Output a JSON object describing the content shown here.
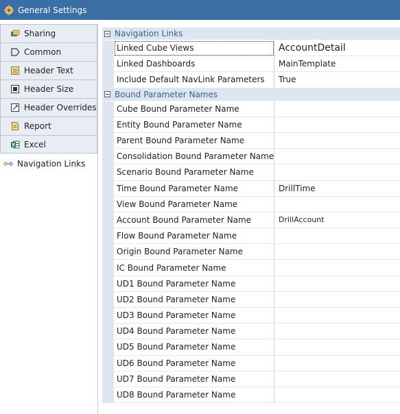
{
  "window": {
    "title": "General Settings"
  },
  "sidebar": {
    "items": [
      {
        "label": "Sharing",
        "icon": "sharing-icon"
      },
      {
        "label": "Common",
        "icon": "common-icon"
      },
      {
        "label": "Header Text",
        "icon": "header-text-icon"
      },
      {
        "label": "Header Size",
        "icon": "header-size-icon"
      },
      {
        "label": "Header Overrides",
        "icon": "header-overrides-icon"
      },
      {
        "label": "Report",
        "icon": "report-icon"
      },
      {
        "label": "Excel",
        "icon": "excel-icon"
      },
      {
        "label": "Navigation Links",
        "icon": "navigation-links-icon",
        "active": true
      }
    ]
  },
  "grid": {
    "nav": {
      "label": "Navigation Links",
      "rows": [
        {
          "name": "Linked Cube Views",
          "value": "AccountDetail"
        },
        {
          "name": "Linked Dashboards",
          "value": "MainTemplate"
        },
        {
          "name": "Include Default NavLink Parameters",
          "value": "True"
        }
      ]
    },
    "bound": {
      "label": "Bound Parameter Names",
      "rows": [
        {
          "name": "Cube Bound Parameter Name",
          "value": ""
        },
        {
          "name": "Entity Bound Parameter Name",
          "value": ""
        },
        {
          "name": "Parent Bound Parameter Name",
          "value": ""
        },
        {
          "name": "Consolidation Bound Parameter Name",
          "value": ""
        },
        {
          "name": "Scenario Bound Parameter Name",
          "value": ""
        },
        {
          "name": "Time Bound Parameter Name",
          "value": "DrillTime"
        },
        {
          "name": "View Bound Parameter Name",
          "value": ""
        },
        {
          "name": "Account Bound Parameter Name",
          "value": "DrillAccount"
        },
        {
          "name": "Flow Bound Parameter Name",
          "value": ""
        },
        {
          "name": "Origin Bound Parameter Name",
          "value": ""
        },
        {
          "name": "IC Bound Parameter Name",
          "value": ""
        },
        {
          "name": "UD1 Bound Parameter Name",
          "value": ""
        },
        {
          "name": "UD2 Bound Parameter Name",
          "value": ""
        },
        {
          "name": "UD3 Bound Parameter Name",
          "value": ""
        },
        {
          "name": "UD4 Bound Parameter Name",
          "value": ""
        },
        {
          "name": "UD5 Bound Parameter Name",
          "value": ""
        },
        {
          "name": "UD6 Bound Parameter Name",
          "value": ""
        },
        {
          "name": "UD7 Bound Parameter Name",
          "value": ""
        },
        {
          "name": "UD8 Bound Parameter Name",
          "value": ""
        }
      ]
    }
  }
}
